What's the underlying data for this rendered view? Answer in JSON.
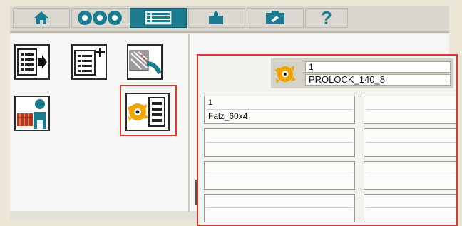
{
  "toolbar": {
    "items": [
      {
        "icon": "home-icon",
        "active": false
      },
      {
        "icon": "tools-icon",
        "active": false
      },
      {
        "icon": "list-icon",
        "active": true
      },
      {
        "icon": "puzzle-icon",
        "active": false
      },
      {
        "icon": "service-icon",
        "active": false
      },
      {
        "icon": "help-icon",
        "label": "?",
        "active": false
      }
    ]
  },
  "colors": {
    "accent_teal": "#1a7c8e",
    "highlight_red": "#d83a32",
    "tool_orange": "#f0a400"
  },
  "left_panel": {
    "buttons": [
      {
        "icon": "list-export-icon"
      },
      {
        "icon": "list-add-icon"
      },
      {
        "icon": "tool-change-icon"
      },
      {
        "icon": "operator-icon"
      },
      {
        "icon": "tool-list-icon",
        "highlighted": true
      }
    ]
  },
  "dialog": {
    "header": {
      "number": "1",
      "name": "PROLOCK_140_8"
    },
    "slots": [
      {
        "number": "1",
        "name": "Falz_60x4"
      },
      {
        "number": "",
        "name": ""
      },
      {
        "number": "",
        "name": ""
      },
      {
        "number": "",
        "name": ""
      },
      {
        "number": "",
        "name": ""
      },
      {
        "number": "",
        "name": ""
      },
      {
        "number": "",
        "name": ""
      },
      {
        "number": "",
        "name": ""
      }
    ]
  }
}
